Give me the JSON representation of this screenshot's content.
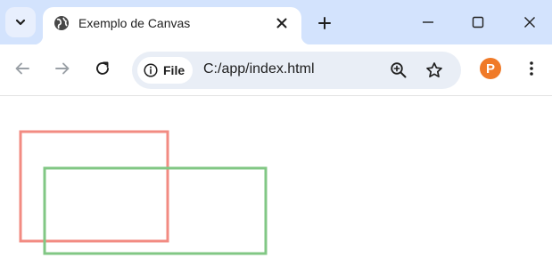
{
  "browser": {
    "tab": {
      "title": "Exemplo de Canvas"
    },
    "address_bar": {
      "chip_label": "File",
      "url": "C:/app/index.html"
    },
    "profile_initial": "P"
  },
  "canvas": {
    "rectangles": [
      {
        "name": "red-rectangle",
        "stroke": "#f28b82"
      },
      {
        "name": "green-rectangle",
        "stroke": "#81c784"
      }
    ]
  },
  "colors": {
    "tabstrip_bg": "#d3e3fd",
    "omnibox_bg": "#e9eef6",
    "profile_bg": "#f07a28"
  },
  "icons": [
    "chevron-down-icon",
    "globe-icon",
    "close-icon",
    "plus-icon",
    "minimize-icon",
    "maximize-icon",
    "back-icon",
    "forward-icon",
    "reload-icon",
    "info-icon",
    "zoom-icon",
    "star-icon",
    "menu-icon"
  ]
}
